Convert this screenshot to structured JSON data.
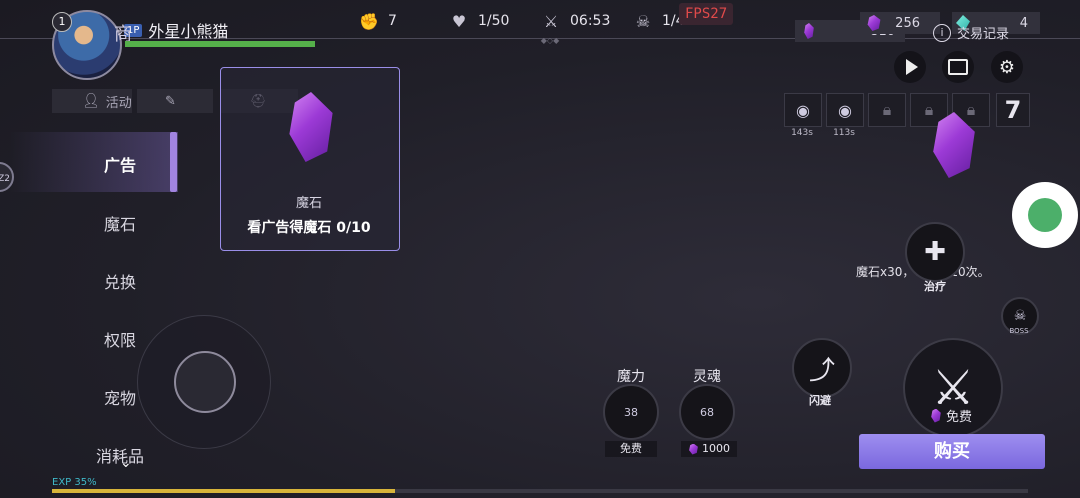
{
  "player": {
    "level": "1",
    "badge": "1P",
    "name": "外星小熊猫",
    "name_prefix": "商"
  },
  "top_stats": [
    {
      "icon": "fist-icon",
      "value": "7"
    },
    {
      "icon": "heart-rate-icon",
      "value": "1/50"
    },
    {
      "icon": "crossed-swords-icon",
      "value": "06:53"
    },
    {
      "icon": "demon-skull-icon",
      "value": "1/4"
    }
  ],
  "fps": "FPS27",
  "resources": {
    "gem_count": "810",
    "purple_count": "256",
    "cyan_count": "4",
    "trade_record": "交易记录"
  },
  "tabs": [
    "活动"
  ],
  "sidebar": {
    "items": [
      "广告",
      "魔石",
      "兑换",
      "权限",
      "宠物",
      "消耗品"
    ],
    "active": "广告",
    "edge_badge": "Z2"
  },
  "card": {
    "title": "魔石",
    "subtitle": "看广告得魔石 0/10"
  },
  "detail": {
    "name": "魔石",
    "desc": "魔石x30，每日限10次。",
    "price_label": "免费",
    "buy_label": "购买"
  },
  "cooldowns": [
    "143s",
    "113s"
  ],
  "wave_number": "7",
  "skills": {
    "heal": "治疗",
    "boss": "BOSS",
    "dodge": "闪避",
    "attack": "攻击",
    "mana_label": "魔力",
    "mana_value": "38",
    "mana_price": "免费",
    "soul_label": "灵魂",
    "soul_value": "68",
    "soul_price": "1000"
  },
  "exp": {
    "label": "EXP 35%",
    "percent": 35
  },
  "colors": {
    "accent": "#9e8ef0",
    "hp": "#55b04a",
    "exp": "#d7b43a",
    "fps": "#e04a4a"
  }
}
